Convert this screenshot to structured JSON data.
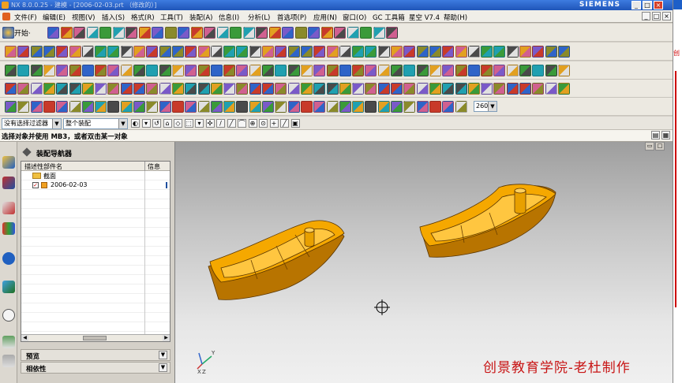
{
  "window": {
    "title": "NX 8.0.0.25 - 建模 - [2006-02-03.prt （修改的）]",
    "brand": "SIEMENS",
    "controls": [
      "_",
      "□",
      "×"
    ]
  },
  "menu": {
    "items": [
      "文件(F)",
      "编辑(E)",
      "视图(V)",
      "插入(S)",
      "格式(R)",
      "工具(T)",
      "装配(A)",
      "信息(I)",
      "分析(L)",
      "首选项(P)",
      "应用(N)",
      "窗口(O)",
      "GC 工具箱",
      "星空 V7.4",
      "帮助(H)"
    ]
  },
  "toolbar": {
    "start_label": "开始·",
    "zoom_value": "260"
  },
  "filter": {
    "type_filter": "没有选择过滤器",
    "scope": "整个装配"
  },
  "cue": "选择对象并使用 MB3，或者双击某一对象",
  "navigator": {
    "title": "装配导航器",
    "columns": [
      "描述性部件名",
      "信息"
    ],
    "rows": [
      {
        "label": "截面",
        "kind": "folder"
      },
      {
        "label": "2006-02-03",
        "kind": "part",
        "checked": true
      }
    ],
    "panels": [
      "预览",
      "相依性"
    ]
  },
  "graphics": {
    "watermark": "创景教育学院-老杜制作",
    "part_color": "#f5a800",
    "part_shadow": "#b87400",
    "axis_labels": {
      "x": "X",
      "y": "Y",
      "z": "Z"
    }
  },
  "side_tag": "创"
}
